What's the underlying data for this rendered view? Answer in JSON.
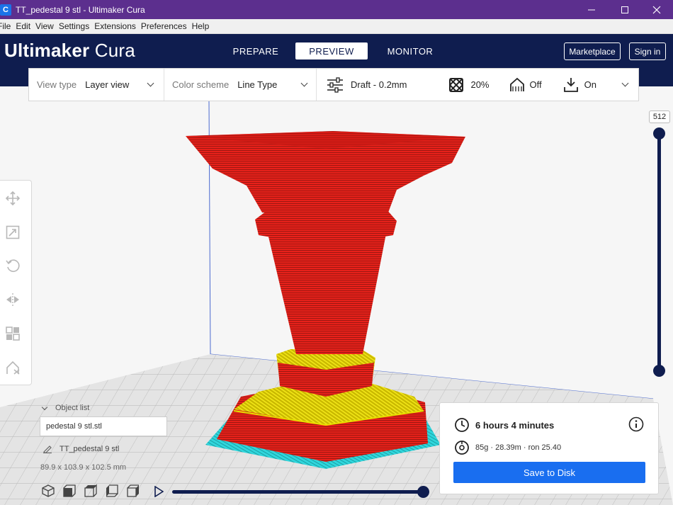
{
  "window": {
    "title": "TT_pedestal 9 stl - Ultimaker Cura",
    "app_icon_letter": "C"
  },
  "menu": {
    "items": [
      "File",
      "Edit",
      "View",
      "Settings",
      "Extensions",
      "Preferences",
      "Help"
    ]
  },
  "header": {
    "logo_bold": "Ultimaker",
    "logo_light": "Cura",
    "stages": [
      "PREPARE",
      "PREVIEW",
      "MONITOR"
    ],
    "active_stage": "PREVIEW",
    "marketplace_label": "Marketplace",
    "signin_label": "Sign in"
  },
  "toolbar": {
    "view_type_label": "View type",
    "view_type_value": "Layer view",
    "color_scheme_label": "Color scheme",
    "color_scheme_value": "Line Type",
    "profile": "Draft - 0.2mm",
    "infill": "20%",
    "support": "Off",
    "adhesion": "On"
  },
  "layer_slider": {
    "value": "512"
  },
  "object_list": {
    "header": "Object list",
    "item": "pedestal 9 stl.stl",
    "selected_name": "TT_pedestal 9 stl",
    "dimensions": "89.9 x 103.9 x 102.5 mm"
  },
  "print_info": {
    "time": "6 hours 4 minutes",
    "material": "85g · 28.39m · ron 25.40",
    "save_label": "Save to Disk"
  },
  "colors": {
    "title_bar": "#5c2f8e",
    "header": "#0f1d4f",
    "accent_blue": "#196ef0",
    "wall_red": "#e8211a",
    "skin_yellow": "#f2e600",
    "skirt_cyan": "#2fd6dc"
  }
}
